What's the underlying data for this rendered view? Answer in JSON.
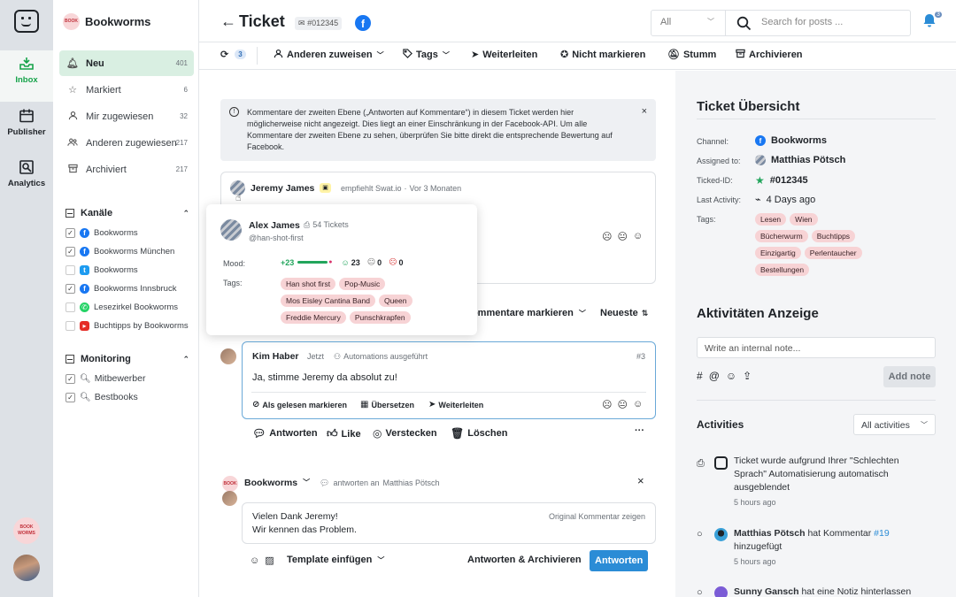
{
  "rail": {
    "items": [
      {
        "label": "Inbox"
      },
      {
        "label": "Publisher"
      },
      {
        "label": "Analytics"
      }
    ],
    "brand_avatar_text": "BOOK WORMS",
    "accent": "#16a34a"
  },
  "sidebar": {
    "workspace_badge": "BOOK",
    "workspace": "Bookworms",
    "nav": [
      {
        "label": "Neu",
        "count": "401",
        "icon": "bell-icon"
      },
      {
        "label": "Markiert",
        "count": "6",
        "icon": "star-icon"
      },
      {
        "label": "Mir zugewiesen",
        "count": "32",
        "icon": "user-icon"
      },
      {
        "label": "Anderen zugewiesen",
        "count": "217",
        "icon": "users-icon"
      },
      {
        "label": "Archiviert",
        "count": "217",
        "icon": "archive-icon"
      }
    ],
    "channels_title": "Kanäle",
    "channels": [
      {
        "label": "Bookworms",
        "checked": "✓",
        "icon": "facebook-icon"
      },
      {
        "label": "Bookworms München",
        "checked": "✓",
        "icon": "facebook-icon"
      },
      {
        "label": "Bookworms",
        "checked": "",
        "icon": "twitter-icon"
      },
      {
        "label": "Bookworms Innsbruck",
        "checked": "✓",
        "icon": "facebook-icon"
      },
      {
        "label": "Lesezirkel Bookworms",
        "checked": "",
        "icon": "whatsapp-icon"
      },
      {
        "label": "Buchtipps by Bookworms",
        "checked": "",
        "icon": "youtube-icon"
      }
    ],
    "monitoring_title": "Monitoring",
    "monitoring": [
      {
        "label": "Mitbewerber",
        "checked": "✓"
      },
      {
        "label": "Bestbooks",
        "checked": "✓"
      }
    ]
  },
  "header": {
    "back": "←",
    "title": "Ticket",
    "ticket_id": "#012345",
    "fb_glyph": "f",
    "filter_value": "All",
    "search_placeholder": "Search for posts ...",
    "notif_count": "3"
  },
  "toolbar": {
    "sync_count": "3",
    "assign": "Anderen zuweisen",
    "tags": "Tags",
    "forward": "Weiterleiten",
    "unmark": "Nicht markieren",
    "mute": "Stumm",
    "archive": "Archivieren"
  },
  "notice": {
    "text": "Kommentare der zweiten Ebene („Antworten auf Kommentare“) in diesem Ticket werden hier möglicherweise nicht angezeigt. Dies liegt an einer Einschränkung in der Facebook-API. Um alle Kommentare der zweiten Ebene zu sehen, überprüfen Sie bitte direkt die entsprechende Bewertung auf Facebook.",
    "close": "×"
  },
  "post": {
    "author": "Jeremy James",
    "action": "empfiehlt Swat.io",
    "separator": "·",
    "time": "Vor 3 Monaten"
  },
  "popup": {
    "name": "Alex James",
    "tickets": "54 Tickets",
    "handle": "@han-shot-first",
    "mood_label": "Mood:",
    "mood_score": "+23",
    "mood_happy": "23",
    "mood_neutral": "0",
    "mood_sad": "0",
    "tags_label": "Tags:",
    "tags": [
      "Han shot first",
      "Pop-Music",
      "Mos Eisley Cantina Band",
      "Queen",
      "Freddie Mercury",
      "Punschkrapfen"
    ],
    "mood_color": "#22a55c"
  },
  "thread_controls": {
    "mark_comments": "Kommentare markieren",
    "sort": "Neueste"
  },
  "reply_card": {
    "author": "Kim Haber",
    "time": "Jetzt",
    "automation": "Automations ausgeführt",
    "index": "#3",
    "text": "Ja, stimme Jeremy da absolut zu!",
    "mark_read": "Als gelesen markieren",
    "translate": "Übersetzen",
    "forward": "Weiterleiten"
  },
  "comment_actions": {
    "reply": "Antworten",
    "like": "Like",
    "hide": "Verstecken",
    "delete": "Löschen",
    "more": "···"
  },
  "composer": {
    "account": "Bookworms",
    "replying_to": "antworten an",
    "replying_name": "Matthias Pötsch",
    "line1": "Vielen Dank Jeremy!",
    "line2": "Wir kennen das Problem.",
    "show_original": "Original Kommentar zeigen",
    "close": "×",
    "template": "Template einfügen",
    "reply_archive": "Antworten & Archivieren",
    "reply": "Antworten",
    "primary_color": "#2b8cd6"
  },
  "overview": {
    "title": "Ticket Übersicht",
    "channel_label": "Channel:",
    "channel": "Bookworms",
    "assigned_label": "Assigned to:",
    "assigned": "Matthias Pötsch",
    "ticket_label": "Ticked-ID:",
    "ticket": "#012345",
    "activity_label": "Last Activity:",
    "activity": "4 Days ago",
    "tags_label": "Tags:",
    "tags": [
      "Lesen",
      "Wien",
      "Bücherwurm",
      "Buchtipps",
      "Einzigartig",
      "Perlentaucher",
      "Bestellungen"
    ]
  },
  "activity_panel": {
    "title": "Aktivitäten Anzeige",
    "note_placeholder": "Write an internal note...",
    "add_note": "Add note",
    "activities_title": "Activities",
    "filter": "All activities",
    "feed": [
      {
        "text": "Ticket wurde aufgrund Ihrer \"Schlechten Sprach\" Automatisierung automatisch ausgeblendet",
        "time": "5 hours ago"
      },
      {
        "actor": "Matthias Pötsch",
        "text": "hat Kommentar",
        "ref": "#19",
        "text2": "hinzugefügt",
        "time": "5 hours ago"
      },
      {
        "actor": "Sunny Gansch",
        "text": "hat eine Notiz hinterlassen"
      }
    ]
  }
}
